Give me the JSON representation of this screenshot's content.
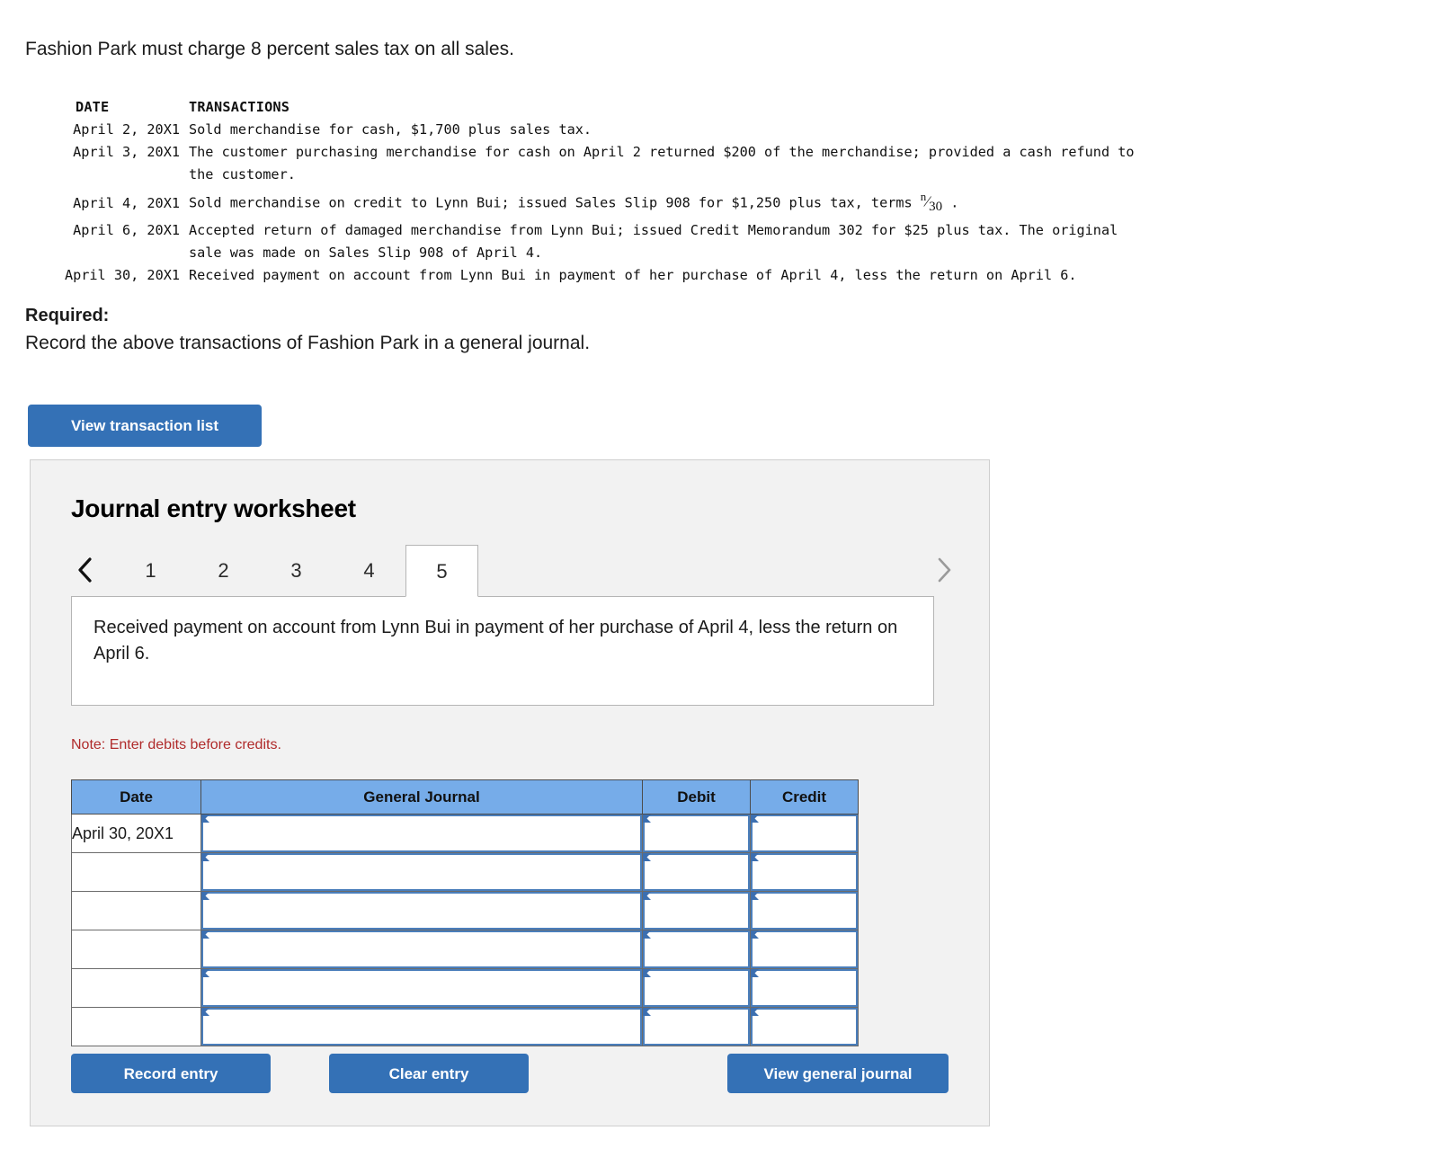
{
  "intro": {
    "text": "Fashion Park must charge 8 percent sales tax on all sales."
  },
  "transactions": {
    "header": {
      "date": "DATE",
      "transactions": "TRANSACTIONS"
    },
    "rows": [
      {
        "date": "April 2, 20X1",
        "lines": [
          "Sold merchandise for cash, $1,700 plus sales tax."
        ]
      },
      {
        "date": "April 3, 20X1",
        "lines": [
          "The customer purchasing merchandise for cash on April 2 returned $200 of the merchandise; provided a cash refund to",
          "the customer."
        ]
      },
      {
        "date": "April 4, 20X1",
        "lines": [
          "Sold merchandise on credit to Lynn Bui; issued Sales Slip 908 for $1,250 plus tax, terms "
        ],
        "fraction": {
          "numerator": "n",
          "denominator": "30"
        },
        "suffix": " ."
      },
      {
        "date": "April 6, 20X1",
        "lines": [
          "Accepted return of damaged merchandise from Lynn Bui; issued Credit Memorandum 302 for $25 plus tax. The original",
          "sale was made on Sales Slip 908 of April 4."
        ]
      },
      {
        "date": "April 30, 20X1",
        "lines": [
          "Received payment on account from Lynn Bui in payment of her purchase of April 4, less the return on April 6."
        ]
      }
    ]
  },
  "required": {
    "label": "Required:",
    "text": "Record the above transactions of Fashion Park in a general journal."
  },
  "buttons": {
    "view_transaction_list": "View transaction list",
    "record_entry": "Record entry",
    "clear_entry": "Clear entry",
    "view_general_journal": "View general journal"
  },
  "worksheet": {
    "title": "Journal entry worksheet",
    "tabs": [
      "1",
      "2",
      "3",
      "4",
      "5"
    ],
    "active_tab": "5",
    "prev_icon": "chevron-left-icon",
    "next_icon": "chevron-right-icon",
    "description": "Received payment on account from Lynn Bui in payment of her purchase of April 4, less the return on April 6.",
    "note": "Note: Enter debits before credits."
  },
  "journal_table": {
    "columns": [
      "Date",
      "General Journal",
      "Debit",
      "Credit"
    ],
    "rows": [
      {
        "date": "April 30, 20X1",
        "general_journal": "",
        "debit": "",
        "credit": ""
      },
      {
        "date": "",
        "general_journal": "",
        "debit": "",
        "credit": ""
      },
      {
        "date": "",
        "general_journal": "",
        "debit": "",
        "credit": ""
      },
      {
        "date": "",
        "general_journal": "",
        "debit": "",
        "credit": ""
      },
      {
        "date": "",
        "general_journal": "",
        "debit": "",
        "credit": ""
      },
      {
        "date": "",
        "general_journal": "",
        "debit": "",
        "credit": ""
      }
    ]
  },
  "colors": {
    "button_blue": "#3471B6",
    "table_header_blue": "#76ACE9",
    "input_border_blue": "#4A7EBB",
    "note_red": "#B02B2B",
    "panel_bg": "#F2F2F2"
  }
}
